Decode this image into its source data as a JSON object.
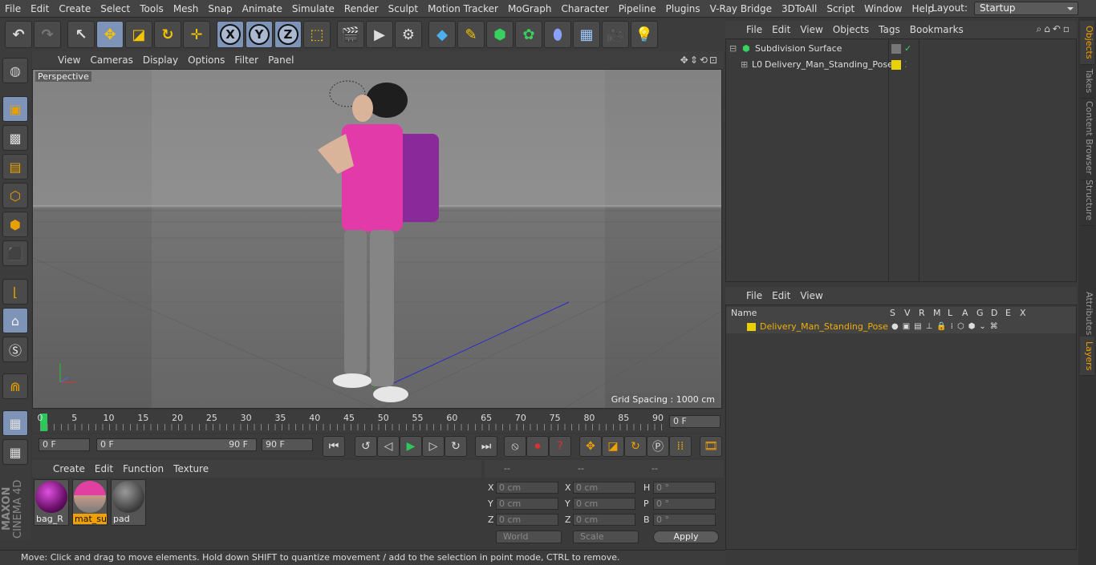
{
  "menu": [
    "File",
    "Edit",
    "Create",
    "Select",
    "Tools",
    "Mesh",
    "Snap",
    "Animate",
    "Simulate",
    "Render",
    "Sculpt",
    "Motion Tracker",
    "MoGraph",
    "Character",
    "Pipeline",
    "Plugins",
    "V-Ray Bridge",
    "3DToAll",
    "Script",
    "Window",
    "Help"
  ],
  "layout": {
    "label": "Layout:",
    "value": "Startup"
  },
  "toolbar": {
    "x": "X",
    "y": "Y",
    "z": "Z"
  },
  "viewport": {
    "menu": [
      "View",
      "Cameras",
      "Display",
      "Options",
      "Filter",
      "Panel"
    ],
    "camera": "Perspective",
    "grid_spacing": "Grid Spacing : 1000 cm"
  },
  "timeline": {
    "ticks": [
      "0",
      "5",
      "10",
      "15",
      "20",
      "25",
      "30",
      "35",
      "40",
      "45",
      "50",
      "55",
      "60",
      "65",
      "70",
      "75",
      "80",
      "85",
      "90"
    ],
    "current_frame": "0 F",
    "start_field": "0 F",
    "range_start": "0 F",
    "range_end": "90 F",
    "end_field": "90 F"
  },
  "materials": {
    "menu": [
      "Create",
      "Edit",
      "Function",
      "Texture"
    ],
    "items": [
      {
        "name": "bag_R",
        "selected": false
      },
      {
        "name": "mat_suit",
        "selected": true
      },
      {
        "name": "pad",
        "selected": false
      }
    ]
  },
  "coordinates": {
    "header": [
      "--",
      "--",
      "--"
    ],
    "rows": [
      {
        "l1": "X",
        "v1": "0 cm",
        "l2": "X",
        "v2": "0 cm",
        "l3": "H",
        "v3": "0 °"
      },
      {
        "l1": "Y",
        "v1": "0 cm",
        "l2": "Y",
        "v2": "0 cm",
        "l3": "P",
        "v3": "0 °"
      },
      {
        "l1": "Z",
        "v1": "0 cm",
        "l2": "Z",
        "v2": "0 cm",
        "l3": "B",
        "v3": "0 °"
      }
    ],
    "mode": "World",
    "transform": "Scale",
    "apply": "Apply"
  },
  "status": "Move: Click and drag to move elements. Hold down SHIFT to quantize movement / add to the selection in point mode, CTRL to remove.",
  "objects": {
    "menu": [
      "File",
      "Edit",
      "View",
      "Objects",
      "Tags",
      "Bookmarks"
    ],
    "items": [
      {
        "name": "Subdivision Surface"
      },
      {
        "name": "Delivery_Man_Standing_Pose"
      }
    ]
  },
  "layers": {
    "menu": [
      "File",
      "Edit",
      "View"
    ],
    "columns": [
      "Name",
      "S",
      "V",
      "R",
      "M",
      "L",
      "A",
      "G",
      "D",
      "E",
      "X"
    ],
    "items": [
      {
        "name": "Delivery_Man_Standing_Pose"
      }
    ]
  },
  "sidetabs": [
    "Objects",
    "Takes",
    "Content Browser",
    "Structure",
    "Attributes",
    "Layers"
  ],
  "logo": {
    "line1": "MAXON",
    "line2": "CINEMA 4D"
  },
  "colors": {
    "accent": "#f0a000",
    "selection": "#7d93b8",
    "layer": "#e8d200"
  }
}
